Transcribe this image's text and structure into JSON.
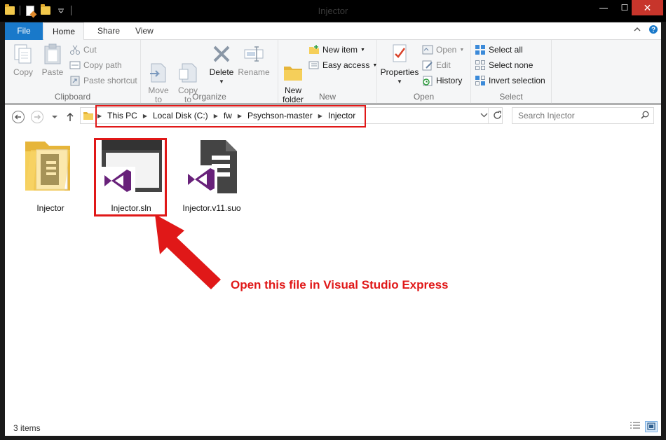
{
  "window": {
    "title": "Injector",
    "controls": {
      "minimize": "—",
      "maximize": "☐",
      "close": "✕"
    }
  },
  "ribbon_tabs": [
    {
      "label": "File"
    },
    {
      "label": "Home"
    },
    {
      "label": "Share"
    },
    {
      "label": "View"
    }
  ],
  "ribbon": {
    "clipboard": {
      "label": "Clipboard",
      "copy": "Copy",
      "paste": "Paste",
      "cut": "Cut",
      "copy_path": "Copy path",
      "paste_shortcut": "Paste shortcut"
    },
    "organize": {
      "label": "Organize",
      "move_to": "Move\nto",
      "copy_to": "Copy\nto",
      "delete": "Delete",
      "rename": "Rename"
    },
    "new": {
      "label": "New",
      "new_folder": "New\nfolder",
      "new_item": "New item",
      "easy_access": "Easy access"
    },
    "open": {
      "label": "Open",
      "properties": "Properties",
      "open": "Open",
      "edit": "Edit",
      "history": "History"
    },
    "select": {
      "label": "Select",
      "select_all": "Select all",
      "select_none": "Select none",
      "invert_selection": "Invert selection"
    }
  },
  "address": {
    "breadcrumbs": [
      "This PC",
      "Local Disk (C:)",
      "fw",
      "Psychson-master",
      "Injector"
    ],
    "search_placeholder": "Search Injector"
  },
  "files": [
    {
      "name": "Injector",
      "type": "folder"
    },
    {
      "name": "Injector.sln",
      "type": "sln"
    },
    {
      "name": "Injector.v11.suo",
      "type": "suo"
    }
  ],
  "annotation": "Open this file in Visual Studio Express",
  "status": {
    "item_count": "3 items"
  },
  "colors": {
    "accent": "#1979ca",
    "highlight": "#e01818",
    "vs_purple": "#68217a"
  }
}
